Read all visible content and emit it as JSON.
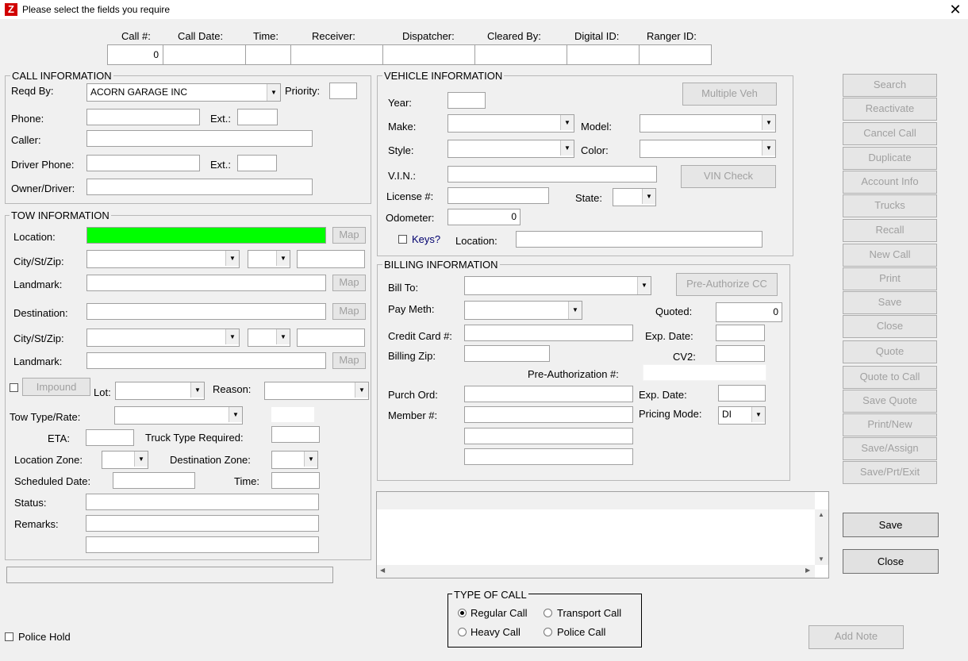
{
  "window": {
    "title": "Please select the fields you require",
    "app_icon": "Z",
    "close_glyph": "✕"
  },
  "header": {
    "labels": [
      "Call #:",
      "Call Date:",
      "Time:",
      "Receiver:",
      "Dispatcher:",
      "Cleared By:",
      "Digital ID:",
      "Ranger ID:"
    ],
    "call_number": "0"
  },
  "call_info": {
    "title": "CALL INFORMATION",
    "reqd_by_label": "Reqd By:",
    "reqd_by_value": "ACORN GARAGE INC",
    "priority_label": "Priority:",
    "phone_label": "Phone:",
    "ext_label": "Ext.:",
    "caller_label": "Caller:",
    "driver_phone_label": "Driver Phone:",
    "ext2_label": "Ext.:",
    "owner_driver_label": "Owner/Driver:"
  },
  "tow_info": {
    "title": "TOW INFORMATION",
    "location_label": "Location:",
    "map_label": "Map",
    "city_label": "City/St/Zip:",
    "landmark_label": "Landmark:",
    "destination_label": "Destination:",
    "city2_label": "City/St/Zip:",
    "landmark2_label": "Landmark:",
    "impound_label": "Impound",
    "lot_label": "Lot:",
    "reason_label": "Reason:",
    "tow_type_label": "Tow Type/Rate:",
    "eta_label": "ETA:",
    "truck_type_label": "Truck Type Required:",
    "location_zone_label": "Location Zone:",
    "destination_zone_label": "Destination Zone:",
    "scheduled_date_label": "Scheduled Date:",
    "time_label": "Time:",
    "status_label": "Status:",
    "remarks_label": "Remarks:"
  },
  "vehicle_info": {
    "title": "VEHICLE INFORMATION",
    "multiple_veh_label": "Multiple Veh",
    "year_label": "Year:",
    "make_label": "Make:",
    "model_label": "Model:",
    "style_label": "Style:",
    "color_label": "Color:",
    "vin_label": "V.I.N.:",
    "vin_check_label": "VIN Check",
    "license_label": "License #:",
    "state_label": "State:",
    "odometer_label": "Odometer:",
    "odometer_value": "0",
    "keys_label": "Keys?",
    "location_label": "Location:"
  },
  "billing_info": {
    "title": "BILLING INFORMATION",
    "bill_to_label": "Bill To:",
    "pre_authorize_label": "Pre-Authorize CC",
    "pay_meth_label": "Pay Meth:",
    "quoted_label": "Quoted:",
    "quoted_value": "0",
    "credit_card_label": "Credit Card #:",
    "exp_date_label": "Exp. Date:",
    "billing_zip_label": "Billing Zip:",
    "cv2_label": "CV2:",
    "pre_auth_num_label": "Pre-Authorization #:",
    "purch_ord_label": "Purch Ord:",
    "exp_date2_label": "Exp. Date:",
    "member_label": "Member #:",
    "pricing_mode_label": "Pricing Mode:",
    "pricing_mode_value": "DI"
  },
  "side_buttons": [
    "Search",
    "Reactivate",
    "Cancel Call",
    "Duplicate",
    "Account Info",
    "Trucks",
    "Recall",
    "New Call",
    "Print",
    "Save",
    "Close",
    "Quote",
    "Quote to Call",
    "Save Quote",
    "Print/New",
    "Save/Assign",
    "Save/Prt/Exit"
  ],
  "main_buttons": {
    "save": "Save",
    "close": "Close",
    "add_note": "Add Note"
  },
  "type_of_call": {
    "title": "TYPE OF CALL",
    "options": [
      "Regular Call",
      "Transport Call",
      "Heavy Call",
      "Police Call"
    ],
    "selected": "Regular Call"
  },
  "police_hold_label": "Police Hold"
}
